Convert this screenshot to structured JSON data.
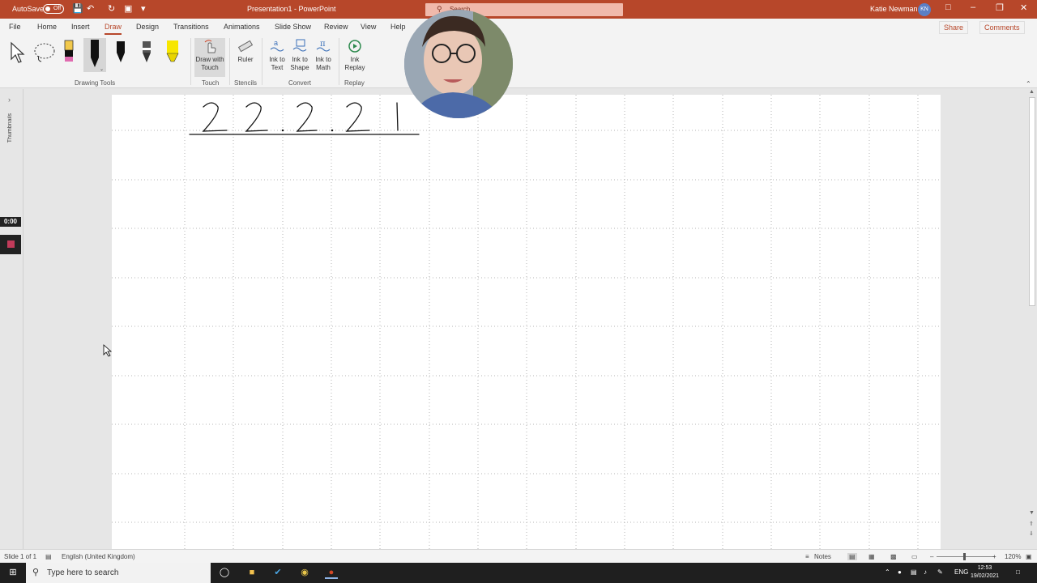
{
  "titlebar": {
    "autosave": "AutoSave",
    "autosave_state": "Off",
    "title": "Presentation1 - PowerPoint",
    "search_placeholder": "Search",
    "user_name": "Katie Newman",
    "user_initials": "KN"
  },
  "tabs": [
    "File",
    "Home",
    "Insert",
    "Draw",
    "Design",
    "Transitions",
    "Animations",
    "Slide Show",
    "Review",
    "View",
    "Help"
  ],
  "active_tab": "Draw",
  "share_label": "Share",
  "comments_label": "Comments",
  "ribbon": {
    "groups": {
      "drawing_tools": "Drawing Tools",
      "touch": "Touch",
      "stencils": "Stencils",
      "convert": "Convert",
      "replay": "Replay"
    },
    "draw_with_touch": "Draw with Touch",
    "ruler": "Ruler",
    "ink_to_text": "Ink to Text",
    "ink_to_shape": "Ink to Shape",
    "ink_to_math": "Ink to Math",
    "ink_replay": "Ink Replay"
  },
  "leftpane": {
    "thumbnails_label": "Thumbnails"
  },
  "recording": {
    "timer": "0:00"
  },
  "slide": {
    "handwriting": "22.2.21"
  },
  "status": {
    "slide_info": "Slide 1 of 1",
    "language": "English (United Kingdom)",
    "notes": "Notes",
    "zoom": "120%"
  },
  "taskbar": {
    "search_placeholder": "Type here to search",
    "lang": "ENG",
    "time": "12:53",
    "date": "19/02/2021"
  },
  "colors": {
    "accent": "#b7472a"
  }
}
